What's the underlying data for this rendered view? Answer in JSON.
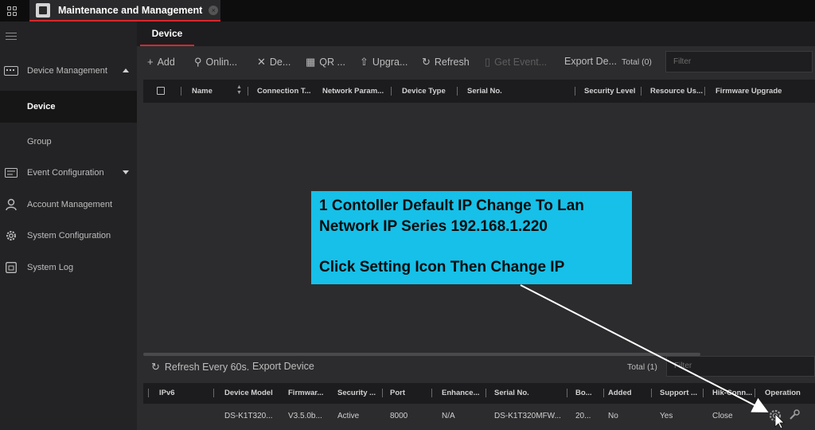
{
  "window": {
    "tab_title": "Maintenance and Management"
  },
  "sidebar": {
    "items": [
      {
        "label": "Device Management",
        "icon": "device-management-icon"
      },
      {
        "label": "Device"
      },
      {
        "label": "Group"
      },
      {
        "label": "Event Configuration",
        "icon": "event-configuration-icon"
      },
      {
        "label": "Account Management",
        "icon": "user-icon"
      },
      {
        "label": "System Configuration",
        "icon": "gear-icon"
      },
      {
        "label": "System Log",
        "icon": "log-icon"
      }
    ]
  },
  "main": {
    "tab": "Device",
    "toolbar": {
      "add": "Add",
      "online": "Onlin...",
      "delete": "De...",
      "qr": "QR ...",
      "upgrade": "Upgra...",
      "refresh": "Refresh",
      "get_events": "Get Event...",
      "export": "Export De...",
      "total": "Total (0)",
      "filter_placeholder": "Filter"
    },
    "columns": [
      "Name",
      "Connection T...",
      "Network Param...",
      "Device Type",
      "Serial No.",
      "Security Level",
      "Resource Us...",
      "Firmware Upgrade"
    ]
  },
  "lower": {
    "refresh_every": "Refresh Every 60s.",
    "export": "Export Device",
    "total": "Total (1)",
    "filter_placeholder": "Filter",
    "columns": [
      "IPv6",
      "Device Model",
      "Firmwar...",
      "Security ...",
      "Port",
      "Enhance...",
      "Serial No.",
      "Bo...",
      "Added",
      "Support ...",
      "Hik-Conn...",
      "Operation"
    ],
    "rows": [
      {
        "ipv6": "",
        "model": "DS-K1T320...",
        "firmware": "V3.5.0b...",
        "security": "Active",
        "port": "8000",
        "enhance": "N/A",
        "serial": "DS-K1T320MFW...",
        "boot": "20...",
        "added": "No",
        "support": "Yes",
        "hik": "Close"
      }
    ]
  },
  "annotation": {
    "line1": "1 Contoller Default IP Change To Lan",
    "line2": "Network IP Series 192.168.1.220",
    "line3": "Click Setting Icon Then Change IP",
    "color": "#16c0e8"
  },
  "colors": {
    "accent": "#d9262b",
    "background": "#2c2c2e",
    "sidebar": "#232325"
  }
}
